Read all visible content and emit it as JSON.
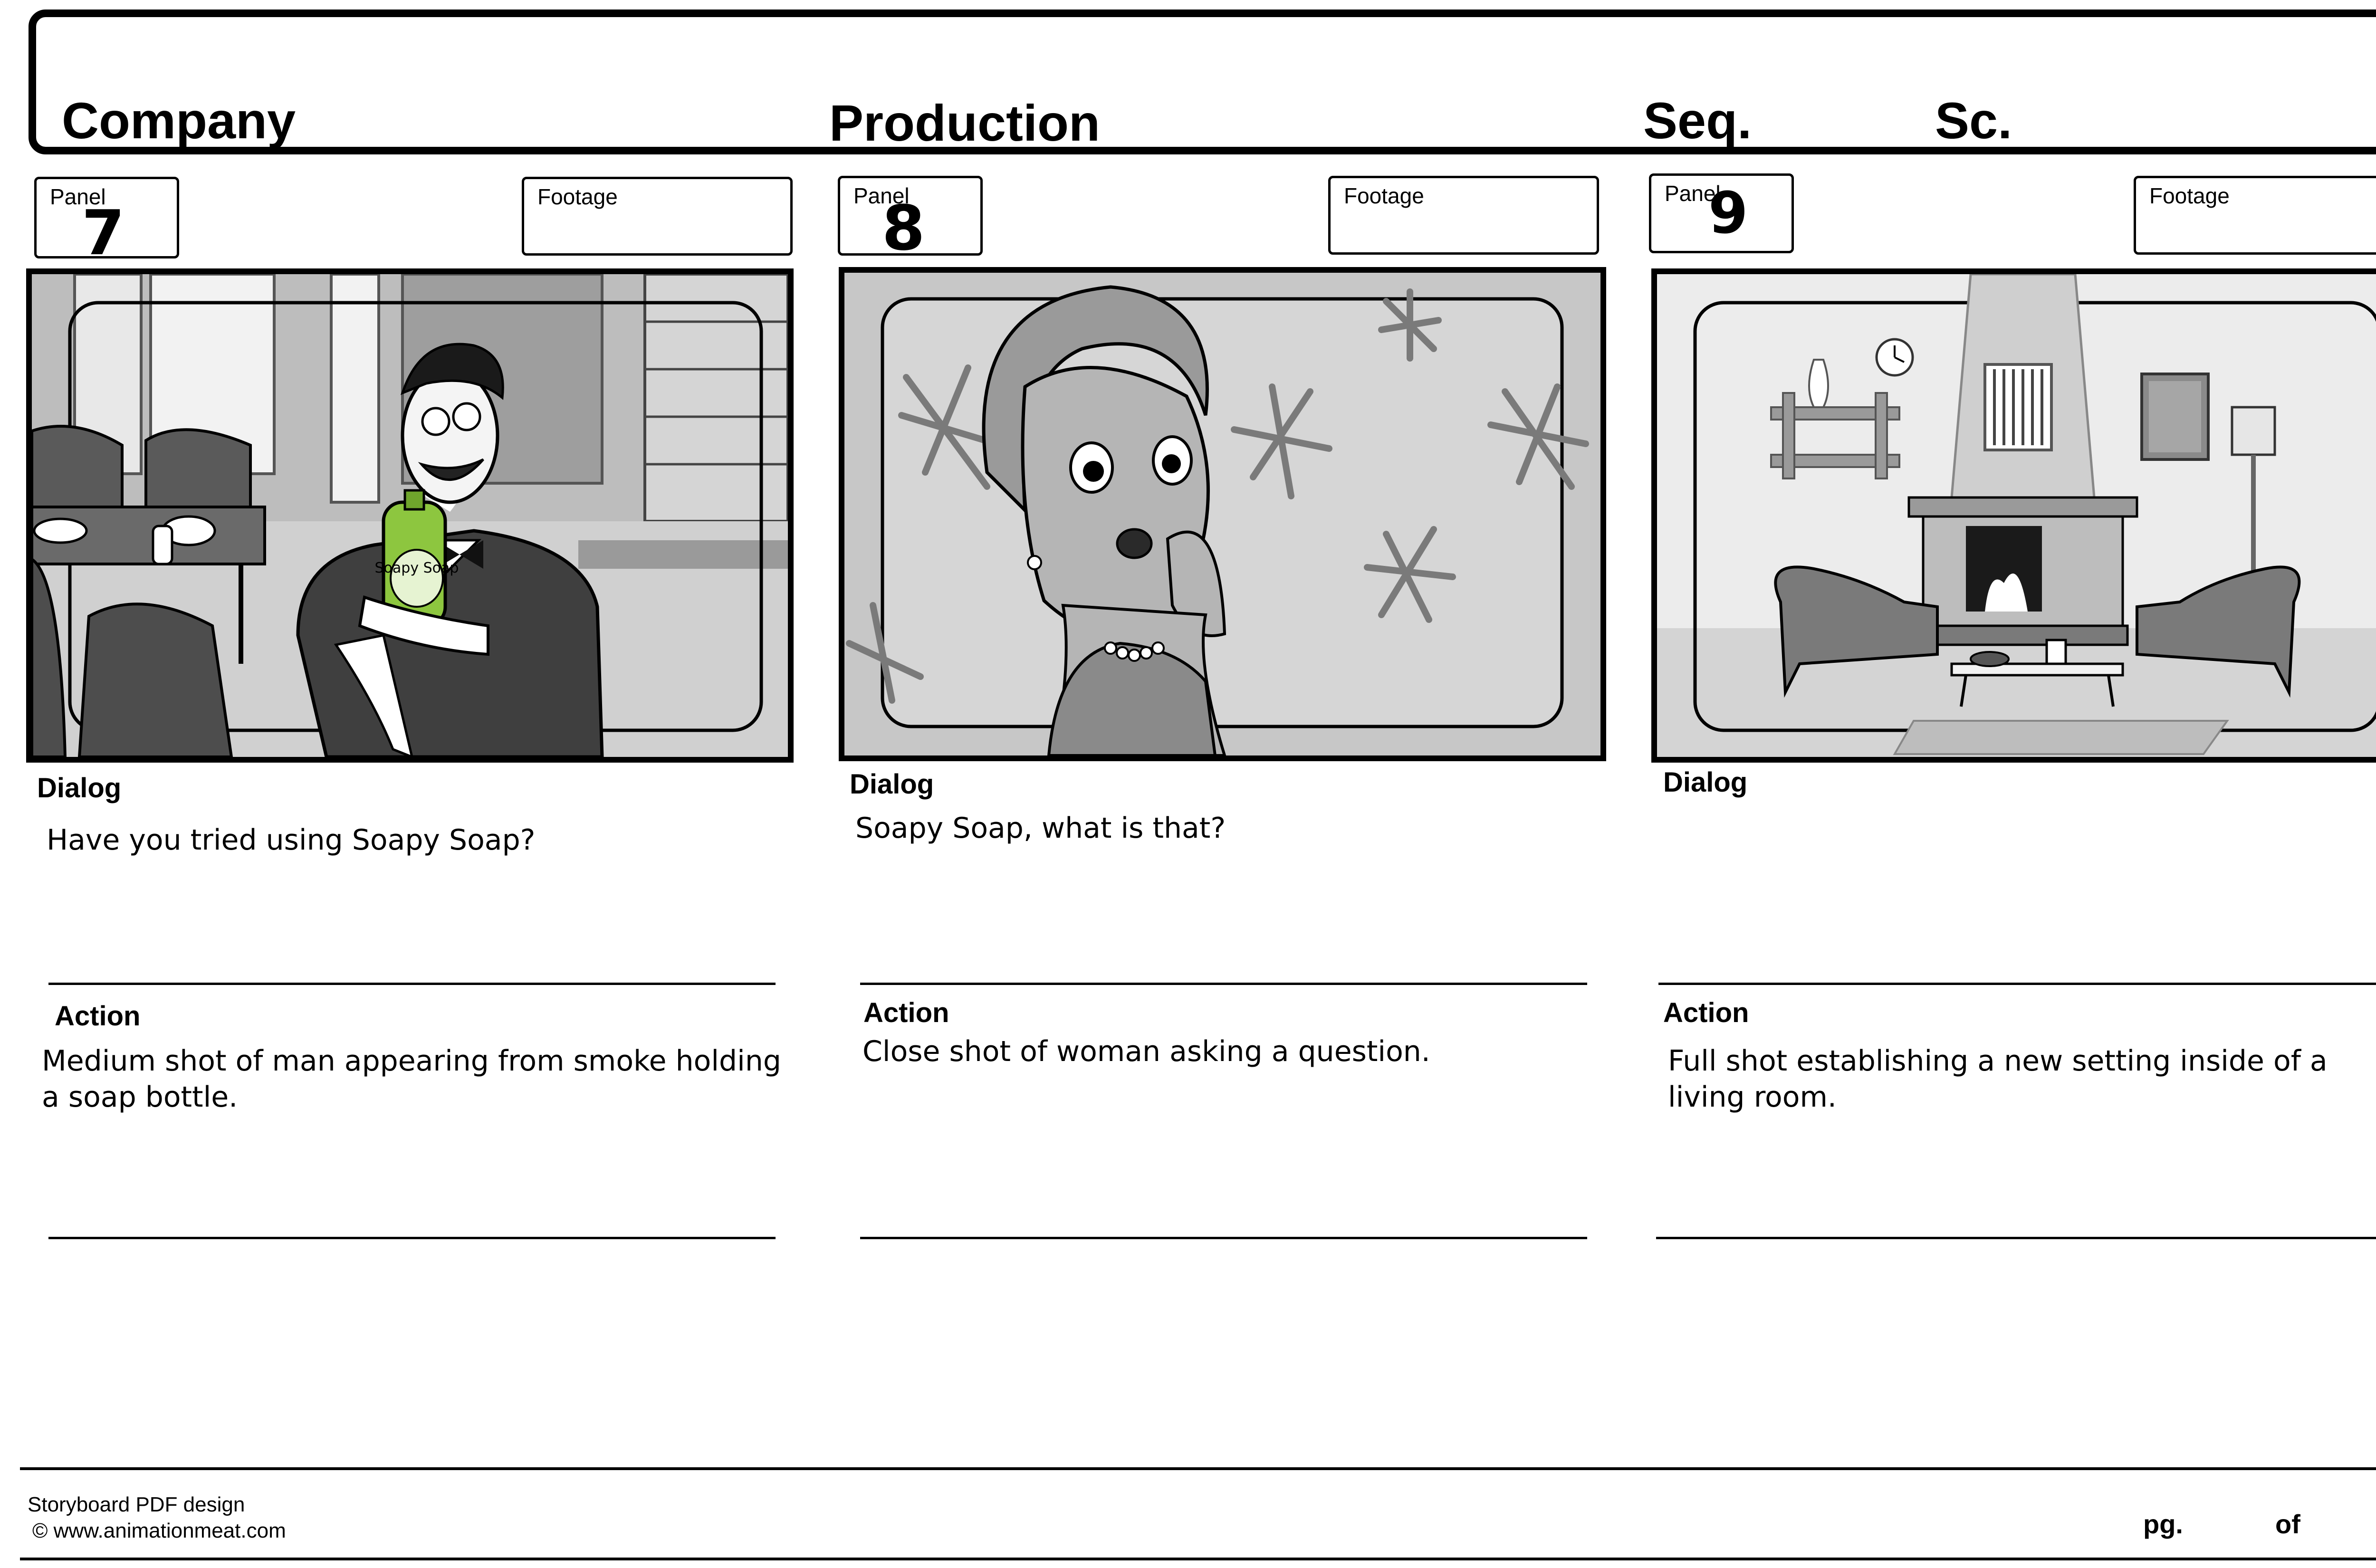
{
  "header": {
    "company_label": "Company",
    "production_label": "Production",
    "seq_label": "Seq.",
    "sc_label": "Sc."
  },
  "panels": [
    {
      "panel_label": "Panel",
      "panel_number": "7",
      "footage_label": "Footage",
      "dialog_label": "Dialog",
      "dialog_text": "Have you tried using Soapy Soap?",
      "action_label": "Action",
      "action_text": "Medium shot of man appearing from smoke holding a soap bottle.",
      "bottle_text": "Soapy Soap"
    },
    {
      "panel_label": "Panel",
      "panel_number": "8",
      "footage_label": "Footage",
      "dialog_label": "Dialog",
      "dialog_text": "Soapy Soap, what is that?",
      "action_label": "Action",
      "action_text": "Close shot of woman asking a question."
    },
    {
      "panel_label": "Panel",
      "panel_number": "9",
      "footage_label": "Footage",
      "dialog_label": "Dialog",
      "dialog_text": "",
      "action_label": "Action",
      "action_text": "Full shot establishing a new setting inside of a living room."
    }
  ],
  "footer": {
    "credit_line1": "Storyboard PDF design",
    "credit_line2": "© www.animationmeat.com",
    "page_label": "pg.",
    "of_label": "of"
  },
  "colors": {
    "ink": "#000000",
    "paper": "#ffffff",
    "soap_green": "#8dc63f"
  }
}
